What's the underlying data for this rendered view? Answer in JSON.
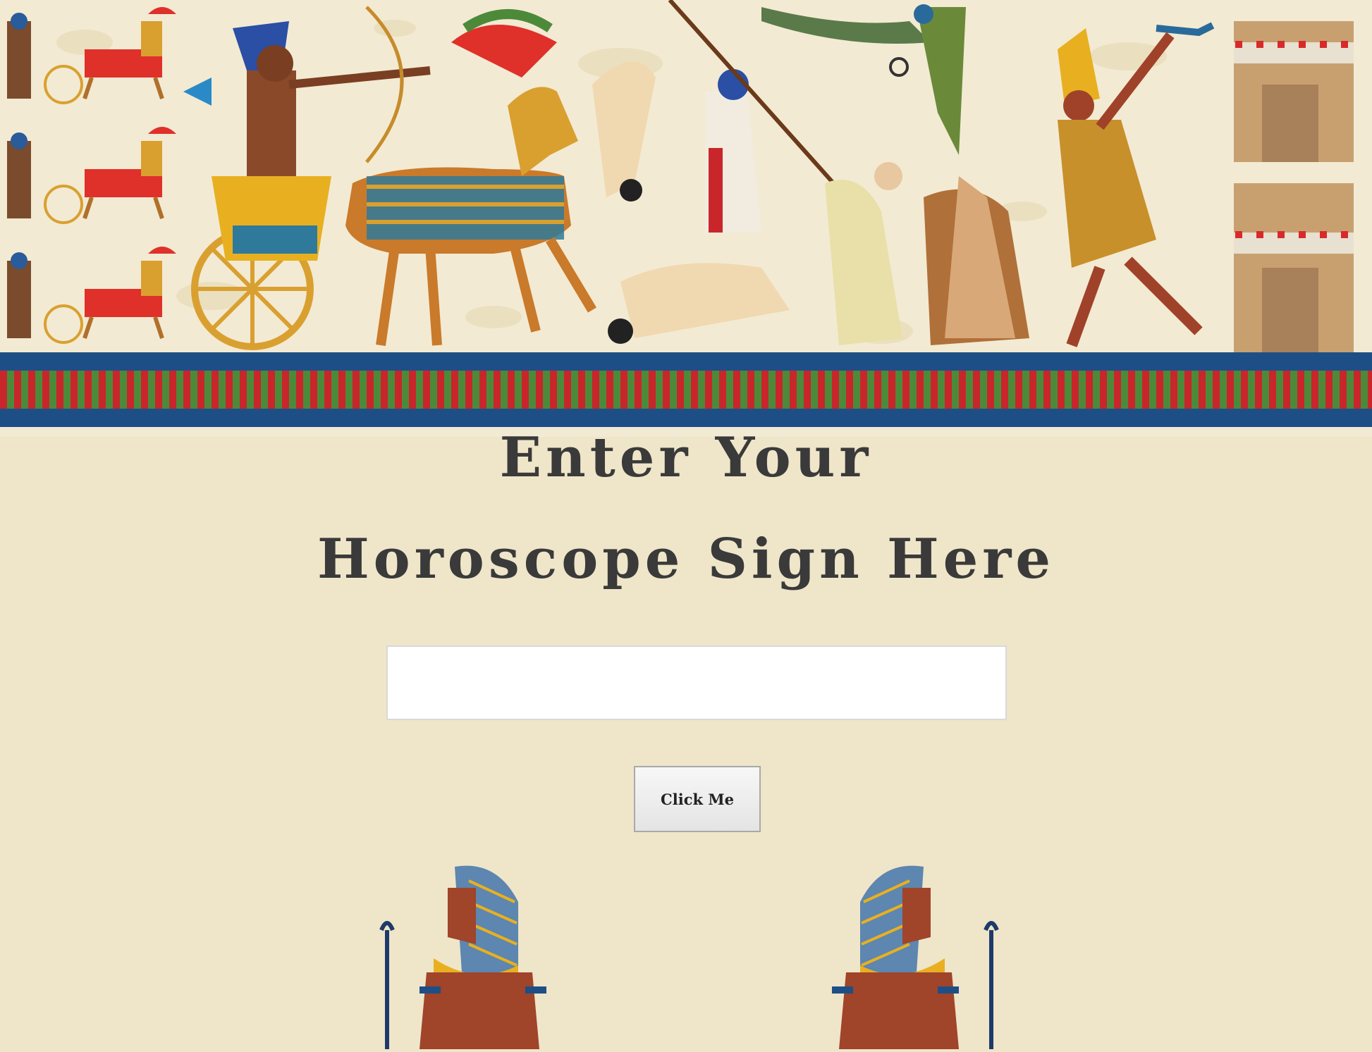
{
  "heading": {
    "line1": "Enter Your",
    "line2": "Horoscope Sign Here"
  },
  "input": {
    "value": "",
    "placeholder": ""
  },
  "button": {
    "label": "Click Me"
  },
  "colors": {
    "page_background": "#efe5c9",
    "heading_text": "#3a3a3a",
    "band_blue": "#1d4f86",
    "band_red": "#c8262b",
    "band_green": "#4c8a3a"
  },
  "images": {
    "banner": "egyptian-battle-mural",
    "figure_left": "pharaoh-figure",
    "figure_right": "pharaoh-figure"
  }
}
